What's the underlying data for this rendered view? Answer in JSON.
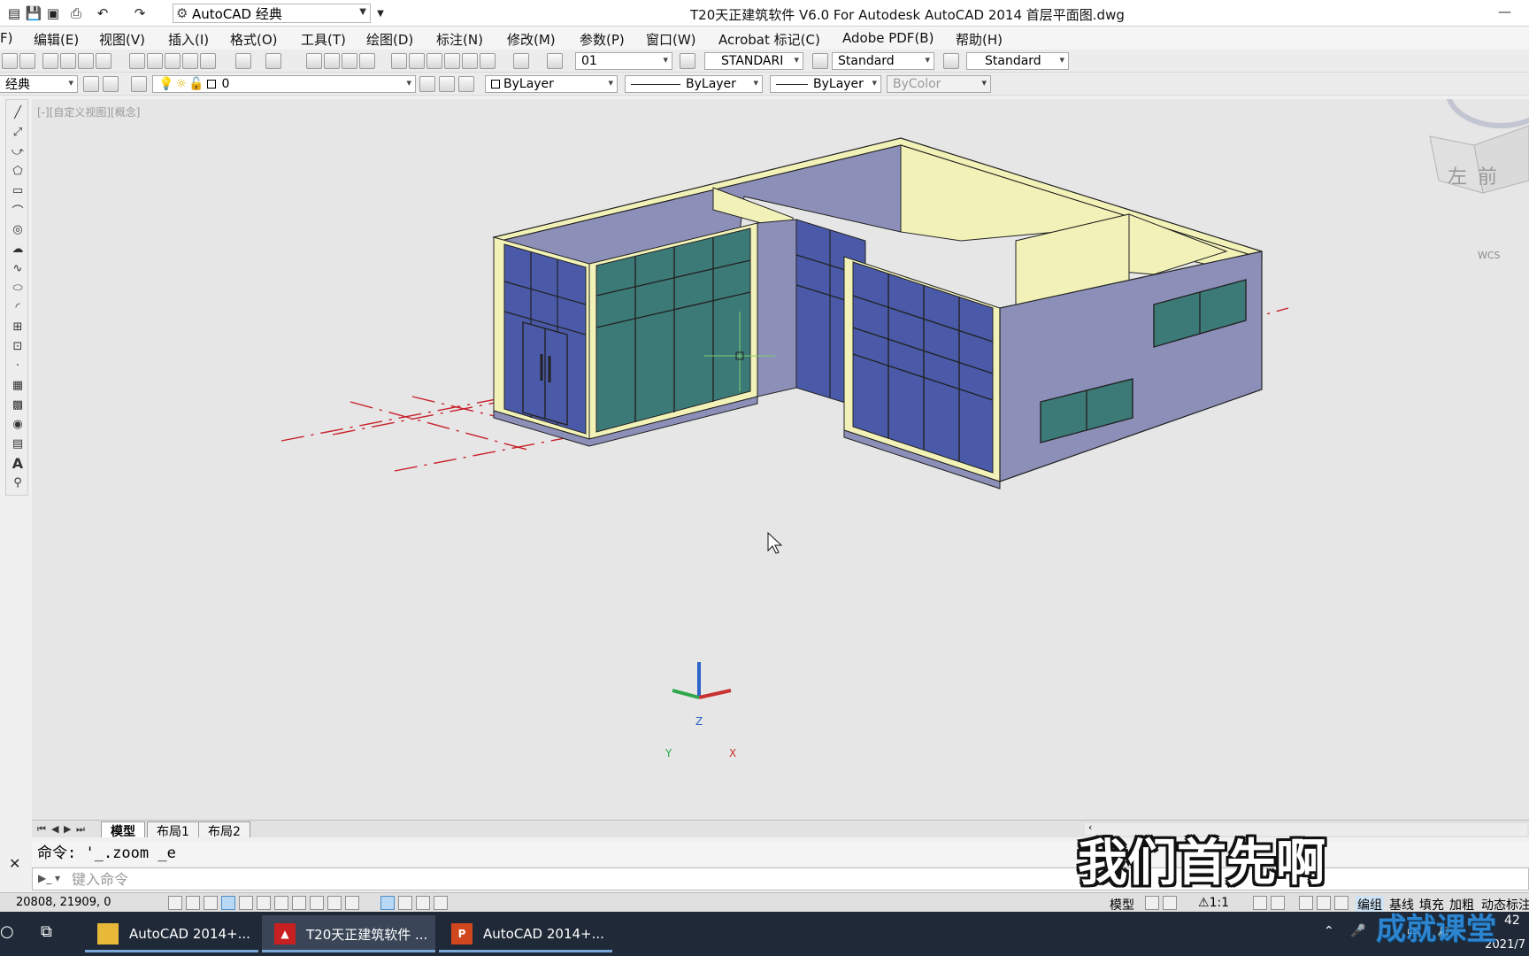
{
  "app": {
    "workspace": "AutoCAD 经典",
    "title": "T20天正建筑软件 V6.0 For Autodesk AutoCAD 2014    首层平面图.dwg"
  },
  "menu": {
    "items": [
      {
        "label": "F)"
      },
      {
        "label": "编辑(E)"
      },
      {
        "label": "视图(V)"
      },
      {
        "label": "插入(I)"
      },
      {
        "label": "格式(O)"
      },
      {
        "label": "工具(T)"
      },
      {
        "label": "绘图(D)"
      },
      {
        "label": "标注(N)"
      },
      {
        "label": "修改(M)"
      },
      {
        "label": "参数(P)"
      },
      {
        "label": "窗口(W)"
      },
      {
        "label": "Acrobat 标记(C)"
      },
      {
        "label": "Adobe PDF(B)"
      },
      {
        "label": "帮助(H)"
      }
    ]
  },
  "styles_toolbar": {
    "text_style": "01",
    "dim_style": "STANDARI",
    "table_style": "Standard",
    "multileader_style": "Standard"
  },
  "layers_toolbar": {
    "workspace_short": "经典",
    "layer": "0",
    "color": "ByLayer",
    "linetype": "ByLayer",
    "lineweight": "ByLayer",
    "plotstyle": "ByColor"
  },
  "viewport": {
    "label": "[-][自定义视图][概念]",
    "wcs": "WCS",
    "viewcube_left": "左",
    "viewcube_front": "前",
    "ucs_x": "X",
    "ucs_y": "Y",
    "ucs_z": "Z"
  },
  "layout_tabs": [
    {
      "label": "模型",
      "active": true
    },
    {
      "label": "布局1",
      "active": false
    },
    {
      "label": "布局2",
      "active": false
    }
  ],
  "command": {
    "history": "命令: '_.zoom _e",
    "placeholder": "键入命令"
  },
  "status": {
    "coords": "20808, 21909, 0",
    "model": "模型",
    "scale": "1:1",
    "right_items": [
      "编组",
      "基线",
      "填充",
      "加粗",
      "动态标注"
    ]
  },
  "taskbar": {
    "items": [
      {
        "label": "AutoCAD 2014+...",
        "icon": "folder-icon"
      },
      {
        "label": "T20天正建筑软件 ...",
        "icon": "autocad-icon"
      },
      {
        "label": "AutoCAD 2014+...",
        "icon": "powerpoint-icon"
      }
    ],
    "time": "42",
    "date": "2021/7"
  },
  "overlay": {
    "subtitle": "我们首先啊",
    "watermark": "成就课堂"
  },
  "colors": {
    "glass_teal": "#3c7a78",
    "glass_blue": "#4a5aa8",
    "wall_purple": "#8c8fb8",
    "wall_yellow": "#f2f2b8",
    "axis_red": "#c8202a"
  }
}
